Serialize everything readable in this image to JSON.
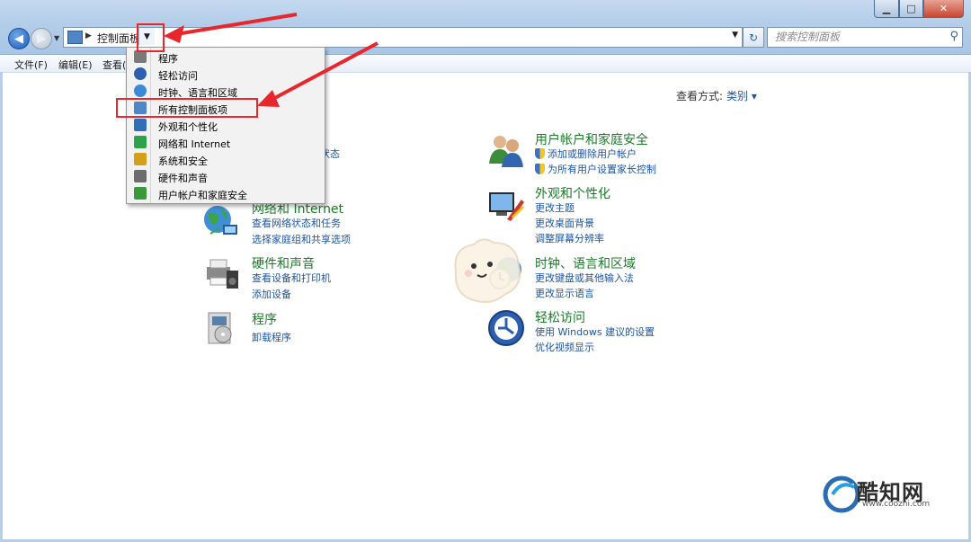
{
  "window": {
    "controls": {
      "minimize": "▁",
      "maximize": "□",
      "close": "✕"
    }
  },
  "address": {
    "crumb": "控制面板"
  },
  "search": {
    "placeholder": "搜索控制面板"
  },
  "menu": {
    "file": "文件(F)",
    "edit": "编辑(E)",
    "view": "查看("
  },
  "view_mode": {
    "label": "查看方式:",
    "value": "类别 ▾"
  },
  "dropdown": {
    "items": [
      {
        "label": "程序",
        "icon": "programs-icon",
        "color": "#7a7a7a"
      },
      {
        "label": "轻松访问",
        "icon": "ease-of-access-icon",
        "color": "#2c5fb0"
      },
      {
        "label": "时钟、语言和区域",
        "icon": "clock-globe-icon",
        "color": "#3b8ad8"
      },
      {
        "label": "所有控制面板项",
        "icon": "control-panel-icon",
        "color": "#4f86c6"
      },
      {
        "label": "外观和个性化",
        "icon": "appearance-icon",
        "color": "#2f6fb7"
      },
      {
        "label": "网络和 Internet",
        "icon": "network-icon",
        "color": "#2aa34a"
      },
      {
        "label": "系统和安全",
        "icon": "system-security-icon",
        "color": "#d4a017"
      },
      {
        "label": "硬件和声音",
        "icon": "hardware-sound-icon",
        "color": "#6d6d6d"
      },
      {
        "label": "用户帐户和家庭安全",
        "icon": "user-accounts-icon",
        "color": "#3a9a3a"
      }
    ]
  },
  "categories": {
    "system_partial": {
      "link": "状态"
    },
    "network": {
      "title": "网络和 Internet",
      "links": [
        "查看网络状态和任务",
        "选择家庭组和共享选项"
      ]
    },
    "hardware": {
      "title": "硬件和声音",
      "links": [
        "查看设备和打印机",
        "添加设备"
      ]
    },
    "programs": {
      "title": "程序",
      "links": [
        "卸载程序"
      ]
    },
    "users": {
      "title": "用户帐户和家庭安全",
      "links": [
        "添加或删除用户帐户",
        "为所有用户设置家长控制"
      ]
    },
    "appearance": {
      "title": "外观和个性化",
      "links": [
        "更改主题",
        "更改桌面背景",
        "调整屏幕分辨率"
      ]
    },
    "clock": {
      "title": "时钟、语言和区域",
      "links": [
        "更改键盘或其他输入法",
        "更改显示语言"
      ]
    },
    "ease": {
      "title": "轻松访问",
      "links": [
        "使用 Windows 建议的设置",
        "优化视频显示"
      ]
    }
  },
  "watermark": {
    "name": "酷知网",
    "url": "www.coozhi.com",
    "logo_text": "C"
  },
  "colors": {
    "accent": "#1e54a4",
    "category_title": "#1d7a2a",
    "highlight": "#e8262b"
  }
}
